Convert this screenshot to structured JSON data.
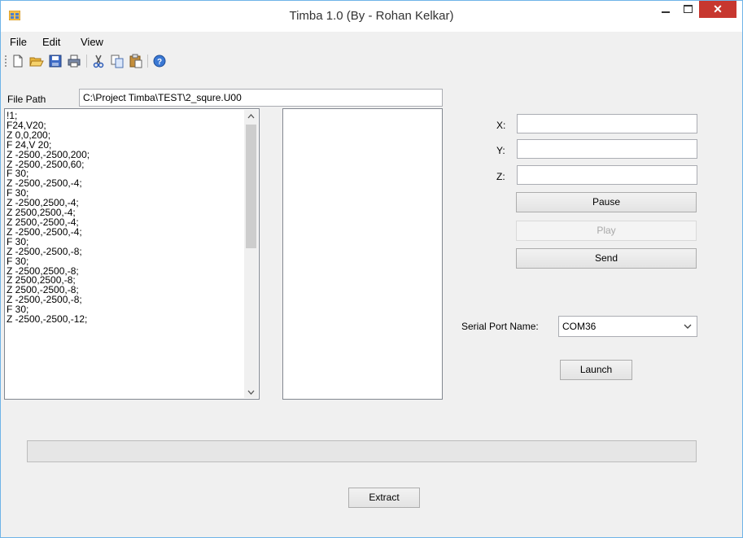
{
  "window": {
    "title": "Timba 1.0 (By - Rohan Kelkar)",
    "close_glyph": "✕"
  },
  "menu": [
    "File",
    "Edit",
    "View"
  ],
  "toolbar": {
    "icons": [
      "new-file-icon",
      "open-folder-icon",
      "save-icon",
      "print-icon",
      "cut-icon",
      "copy-icon",
      "paste-icon",
      "help-icon"
    ]
  },
  "file_path": {
    "label": "File Path",
    "value": "C:\\Project Timba\\TEST\\2_squre.U00"
  },
  "code_lines": [
    "!1;",
    "F24,V20;",
    "Z 0,0,200;",
    "F 24,V 20;",
    "Z -2500,-2500,200;",
    "Z -2500,-2500,60;",
    "F 30;",
    "Z -2500,-2500,-4;",
    "F 30;",
    "Z -2500,2500,-4;",
    "Z 2500,2500,-4;",
    "Z 2500,-2500,-4;",
    "Z -2500,-2500,-4;",
    "F 30;",
    "Z -2500,-2500,-8;",
    "F 30;",
    "Z -2500,2500,-8;",
    "Z 2500,2500,-8;",
    "Z 2500,-2500,-8;",
    "Z -2500,-2500,-8;",
    "F 30;",
    "Z -2500,-2500,-12;"
  ],
  "coords": {
    "x_label": "X:",
    "y_label": "Y:",
    "z_label": "Z:",
    "x_value": "",
    "y_value": "",
    "z_value": ""
  },
  "buttons": {
    "pause": "Pause",
    "play": "Play",
    "send": "Send",
    "launch": "Launch",
    "extract": "Extract"
  },
  "serial": {
    "label": "Serial Port Name:",
    "value": "COM36"
  },
  "progress": {
    "percent": 0
  },
  "colors": {
    "close_button": "#c7372f",
    "window_border": "#6fb4e8",
    "form_background": "#f0f0f0"
  }
}
